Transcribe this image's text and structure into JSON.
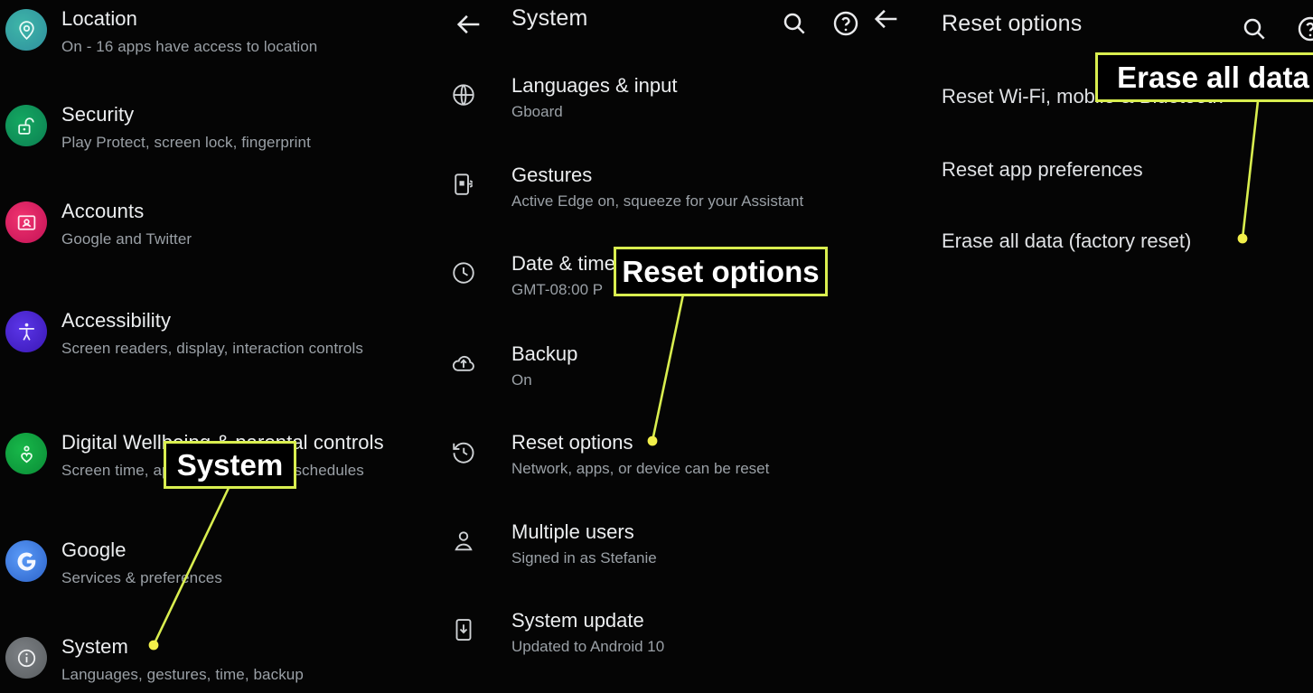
{
  "colors": {
    "background": "#050505",
    "primary_text": "#eceef0",
    "secondary_text": "#9aa0a6",
    "callout_border": "#d9ee4f",
    "callout_fill": "#000000",
    "leader_line": "#d9ee4f",
    "icon_location": "#3ba99c",
    "icon_security": "#0f9d58",
    "icon_accounts": "#e52e71",
    "icon_accessibility": "#4527d6",
    "icon_wellbeing": "#0fa53f",
    "icon_google": "#4285f4",
    "icon_system": "#6e7275"
  },
  "settings_panel": {
    "items": [
      {
        "icon": "location-pin-icon",
        "title": "Location",
        "subtitle": "On - 16 apps have access to location"
      },
      {
        "icon": "unlocked-padlock-icon",
        "title": "Security",
        "subtitle": "Play Protect, screen lock, fingerprint"
      },
      {
        "icon": "account-card-icon",
        "title": "Accounts",
        "subtitle": "Google and Twitter"
      },
      {
        "icon": "accessibility-icon",
        "title": "Accessibility",
        "subtitle": "Screen readers, display, interaction controls"
      },
      {
        "icon": "wellbeing-heart-icon",
        "title": "Digital Wellbeing & parental controls",
        "subtitle": "Screen time, app timers, bedtime schedules"
      },
      {
        "icon": "google-g-icon",
        "title": "Google",
        "subtitle": "Services & preferences"
      },
      {
        "icon": "info-circle-icon",
        "title": "System",
        "subtitle": "Languages, gestures, time, backup"
      }
    ]
  },
  "system_panel": {
    "header": {
      "back_label": "back-arrow",
      "title": "System",
      "search_label": "search",
      "help_label": "help"
    },
    "items": [
      {
        "icon": "globe-icon",
        "title": "Languages & input",
        "subtitle": "Gboard"
      },
      {
        "icon": "gesture-phone-icon",
        "title": "Gestures",
        "subtitle": "Active Edge on, squeeze for your Assistant"
      },
      {
        "icon": "clock-icon",
        "title": "Date & time",
        "subtitle": "GMT-08:00 P"
      },
      {
        "icon": "cloud-upload-icon",
        "title": "Backup",
        "subtitle": "On"
      },
      {
        "icon": "restore-clock-icon",
        "title": "Reset options",
        "subtitle": "Network, apps, or device can be reset"
      },
      {
        "icon": "person-icon",
        "title": "Multiple users",
        "subtitle": "Signed in as Stefanie"
      },
      {
        "icon": "system-update-icon",
        "title": "System update",
        "subtitle": "Updated to Android 10"
      }
    ]
  },
  "reset_panel": {
    "header": {
      "back_label": "back-arrow",
      "title": "Reset options",
      "search_label": "search",
      "help_label": "help"
    },
    "items": [
      {
        "title": "Reset Wi-Fi, mobile & Bluetooth"
      },
      {
        "title": "Reset app preferences"
      },
      {
        "title": "Erase all data (factory reset)"
      }
    ]
  },
  "callouts": [
    {
      "name": "system-callout",
      "text": "System"
    },
    {
      "name": "reset-options-callout",
      "text": "Reset options"
    },
    {
      "name": "erase-all-data-callout",
      "text": "Erase all data"
    }
  ]
}
